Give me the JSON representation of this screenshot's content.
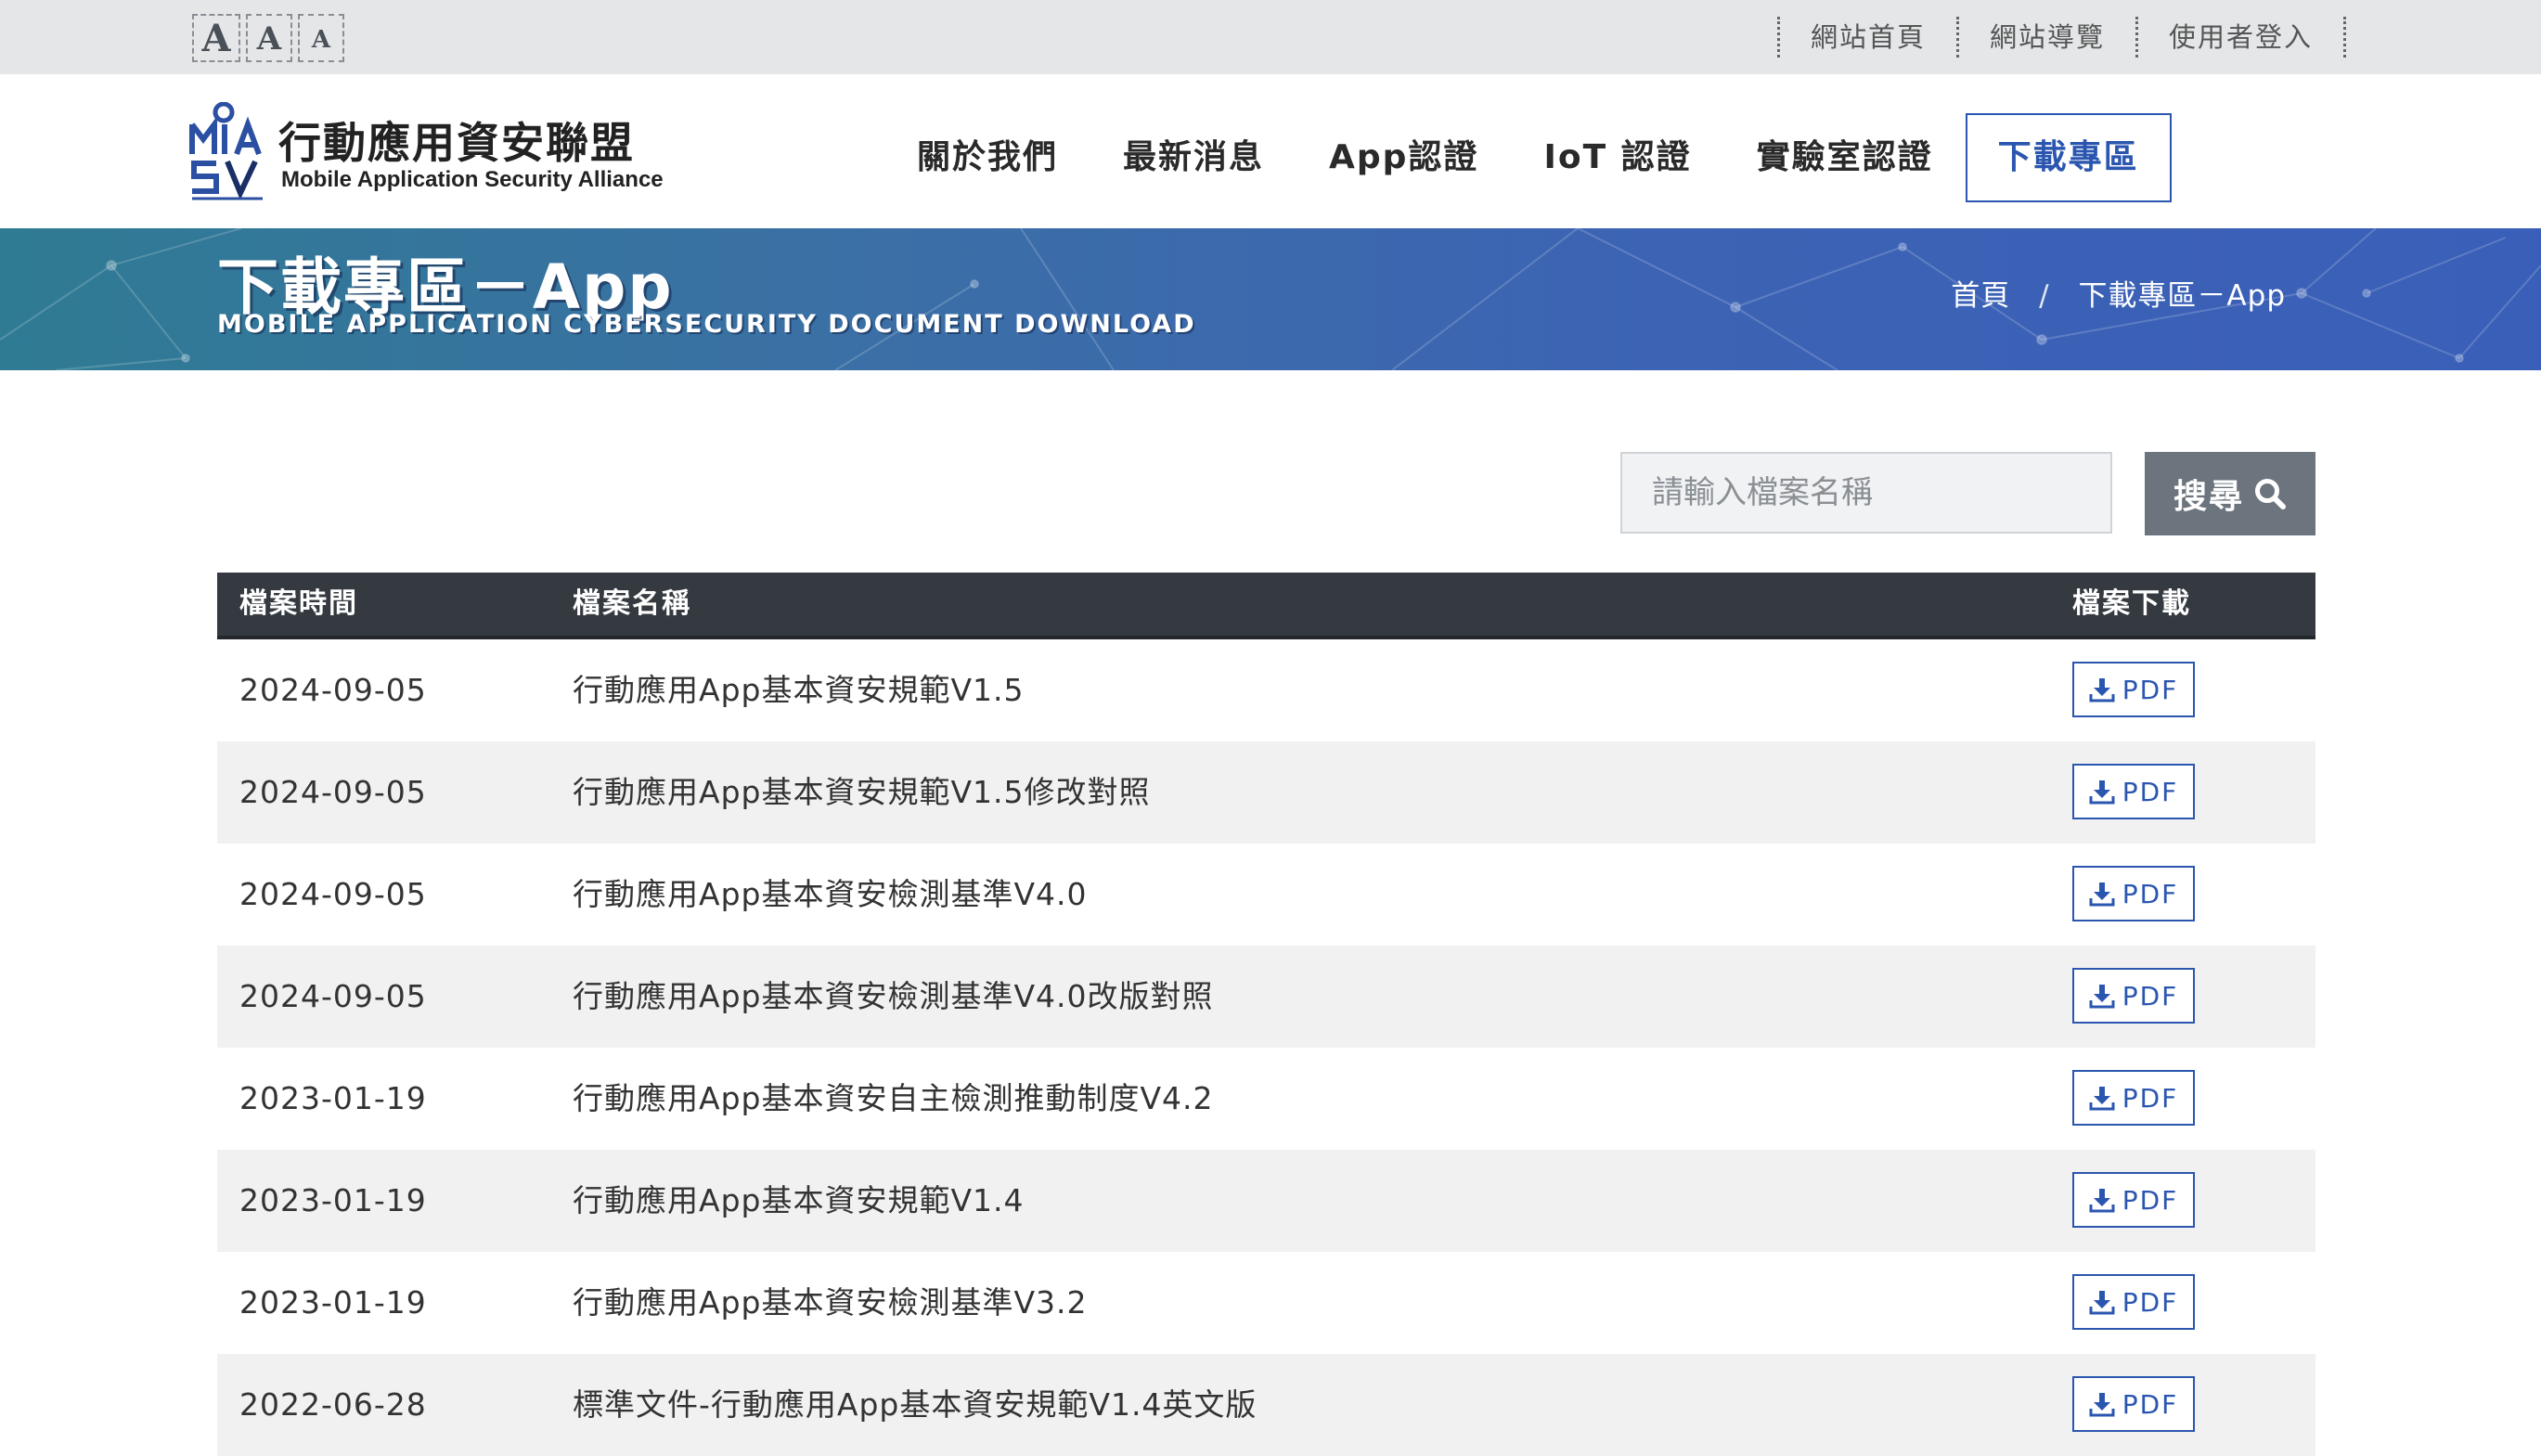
{
  "font_size_controls": [
    "A",
    "A",
    "A"
  ],
  "top_links": [
    "網站首頁",
    "網站導覽",
    "使用者登入"
  ],
  "logo": {
    "name_zh": "行動應用資安聯盟",
    "name_en": "Mobile Application Security Alliance"
  },
  "nav": [
    "關於我們",
    "最新消息",
    "App認證",
    "IoT 認證",
    "實驗室認證",
    "下載專區"
  ],
  "nav_active": "下載專區",
  "banner": {
    "title": "下載專區－App",
    "subtitle": "MOBILE APPLICATION CYBERSECURITY DOCUMENT DOWNLOAD",
    "breadcrumb": [
      "首頁",
      "下載專區－App"
    ],
    "breadcrumb_sep": "/"
  },
  "search": {
    "placeholder": "請輸入檔案名稱",
    "button_label": "搜尋"
  },
  "table": {
    "headers": [
      "檔案時間",
      "檔案名稱",
      "檔案下載"
    ],
    "download_label": "PDF",
    "rows": [
      {
        "date": "2024-09-05",
        "name": "行動應用App基本資安規範V1.5"
      },
      {
        "date": "2024-09-05",
        "name": "行動應用App基本資安規範V1.5修改對照"
      },
      {
        "date": "2024-09-05",
        "name": "行動應用App基本資安檢測基準V4.0"
      },
      {
        "date": "2024-09-05",
        "name": "行動應用App基本資安檢測基準V4.0改版對照"
      },
      {
        "date": "2023-01-19",
        "name": "行動應用App基本資安自主檢測推動制度V4.2"
      },
      {
        "date": "2023-01-19",
        "name": "行動應用App基本資安規範V1.4"
      },
      {
        "date": "2023-01-19",
        "name": "行動應用App基本資安檢測基準V3.2"
      },
      {
        "date": "2022-06-28",
        "name": "標準文件-行動應用App基本資安規範V1.4英文版"
      }
    ]
  },
  "colors": {
    "accent": "#2b56b0",
    "table_header": "#343a40",
    "search_button": "#6c757d"
  },
  "icons": {
    "search": "search-icon",
    "download": "download-icon"
  }
}
